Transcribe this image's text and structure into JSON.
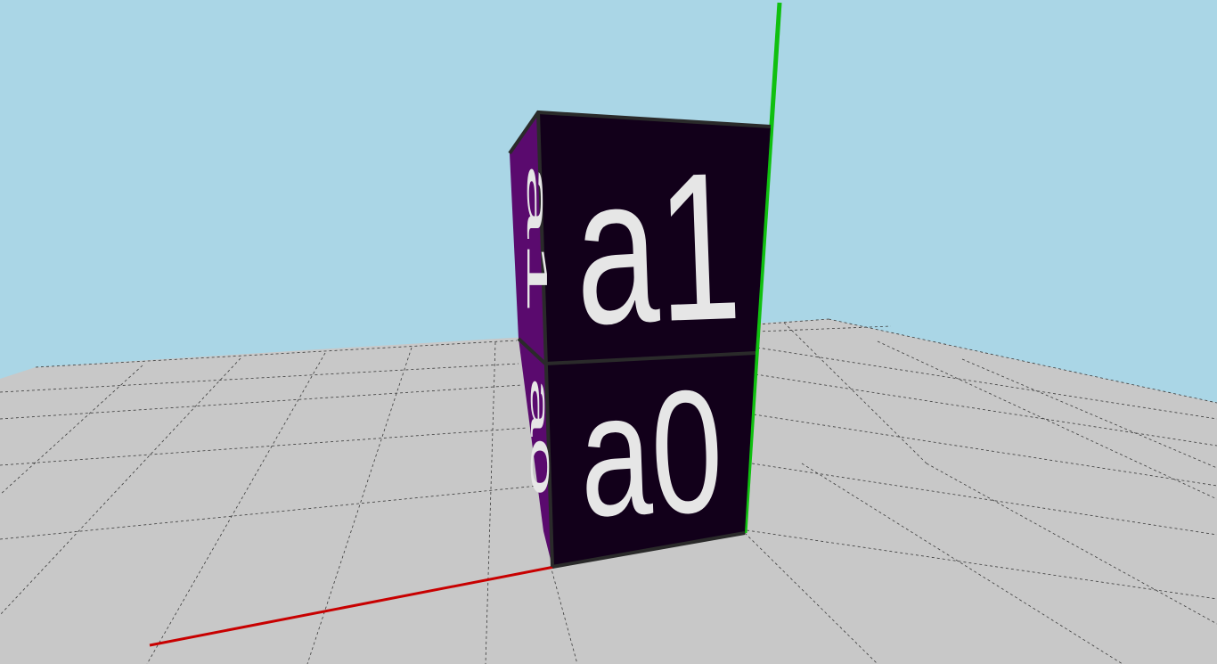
{
  "scene": {
    "sky_color": "#aad6e6",
    "floor_color": "#c8c8c8",
    "grid_line_color": "#3a3a3a",
    "x_axis_color": "#c80000",
    "y_axis_color": "#10c010",
    "cube_front_color": "#12001a",
    "cube_side_color": "#5a0a6e",
    "cube_edge_color": "#2a2a2a",
    "label_color": "#e6e6e6"
  },
  "cubes": [
    {
      "label": "a1"
    },
    {
      "label": "a0"
    }
  ]
}
